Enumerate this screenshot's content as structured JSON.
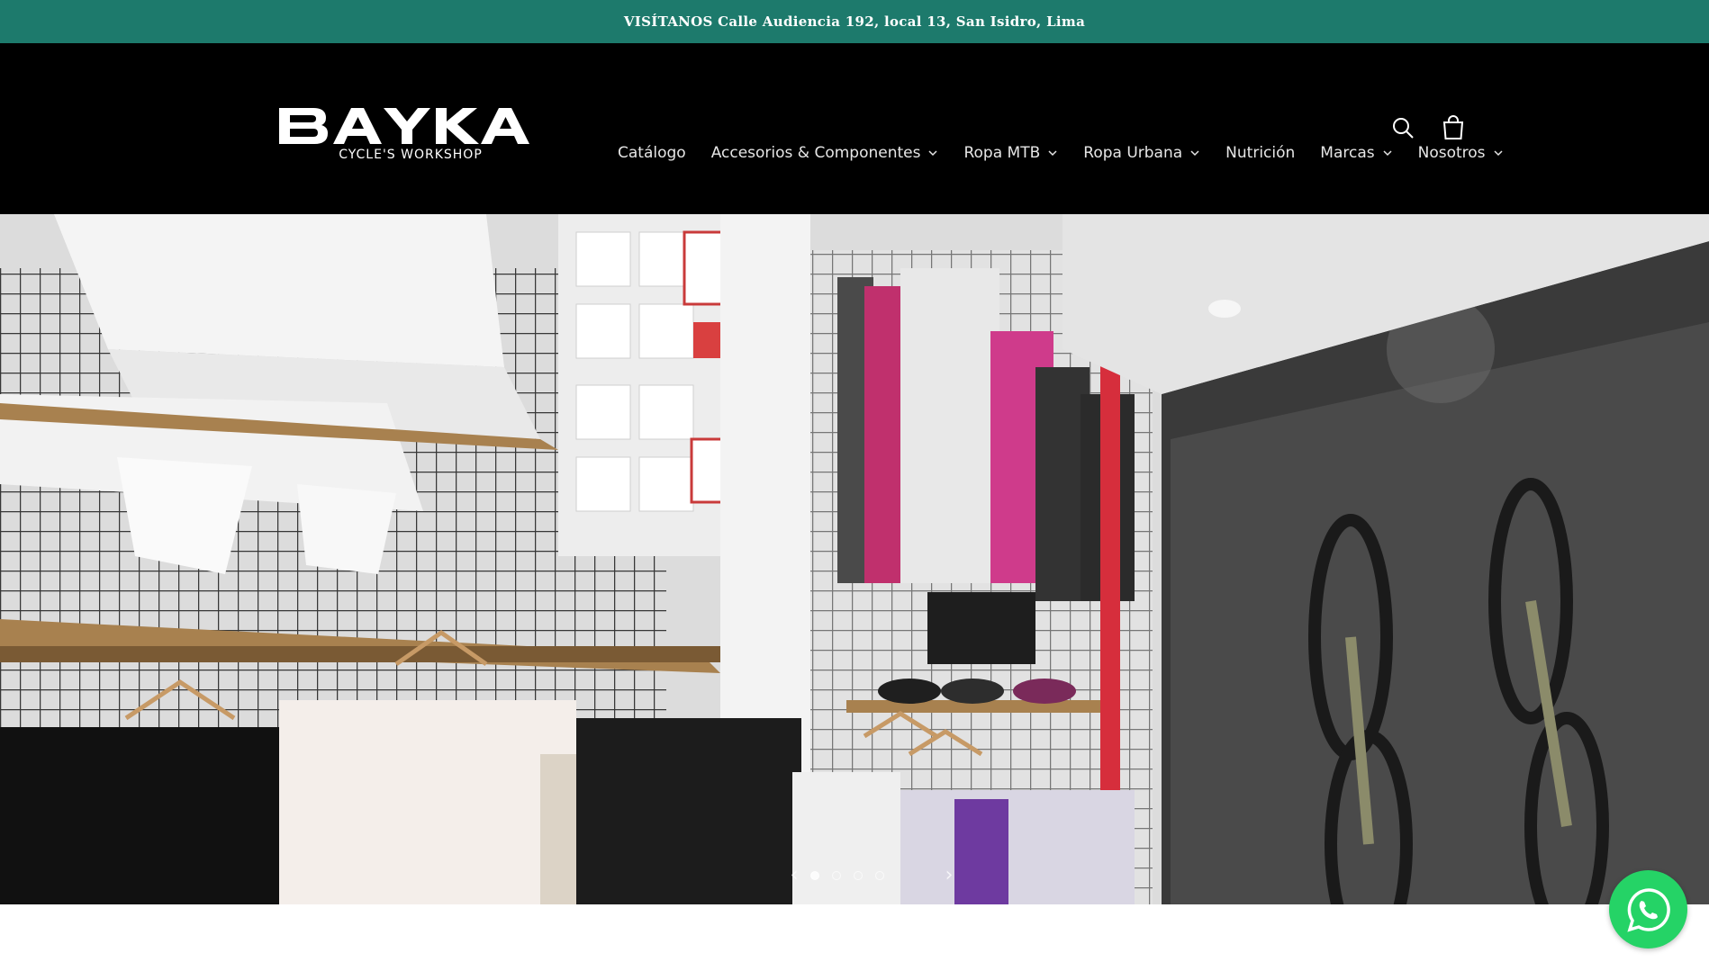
{
  "announcement": {
    "text": "VISÍTANOS Calle Audiencia 192, local 13, San Isidro, Lima"
  },
  "brand": {
    "name": "BAYKA",
    "tagline": "CYCLE'S  WORKSHOP"
  },
  "nav": {
    "items": [
      {
        "label": "Catálogo",
        "has_dropdown": false
      },
      {
        "label": "Accesorios & Componentes",
        "has_dropdown": true
      },
      {
        "label": "Ropa MTB",
        "has_dropdown": true
      },
      {
        "label": "Ropa Urbana",
        "has_dropdown": true
      },
      {
        "label": "Nutrición",
        "has_dropdown": false
      },
      {
        "label": "Marcas",
        "has_dropdown": true
      },
      {
        "label": "Nosotros",
        "has_dropdown": true
      }
    ]
  },
  "header_icons": {
    "search": "search-icon",
    "cart": "cart-icon"
  },
  "hero": {
    "image": "store-interior-photo",
    "slides": 4,
    "active_slide": 1
  },
  "whatsapp": {
    "icon": "whatsapp-icon"
  },
  "colors": {
    "announcement_bg": "#1d7a6c",
    "header_bg": "#000000",
    "whatsapp": "#25d366"
  }
}
